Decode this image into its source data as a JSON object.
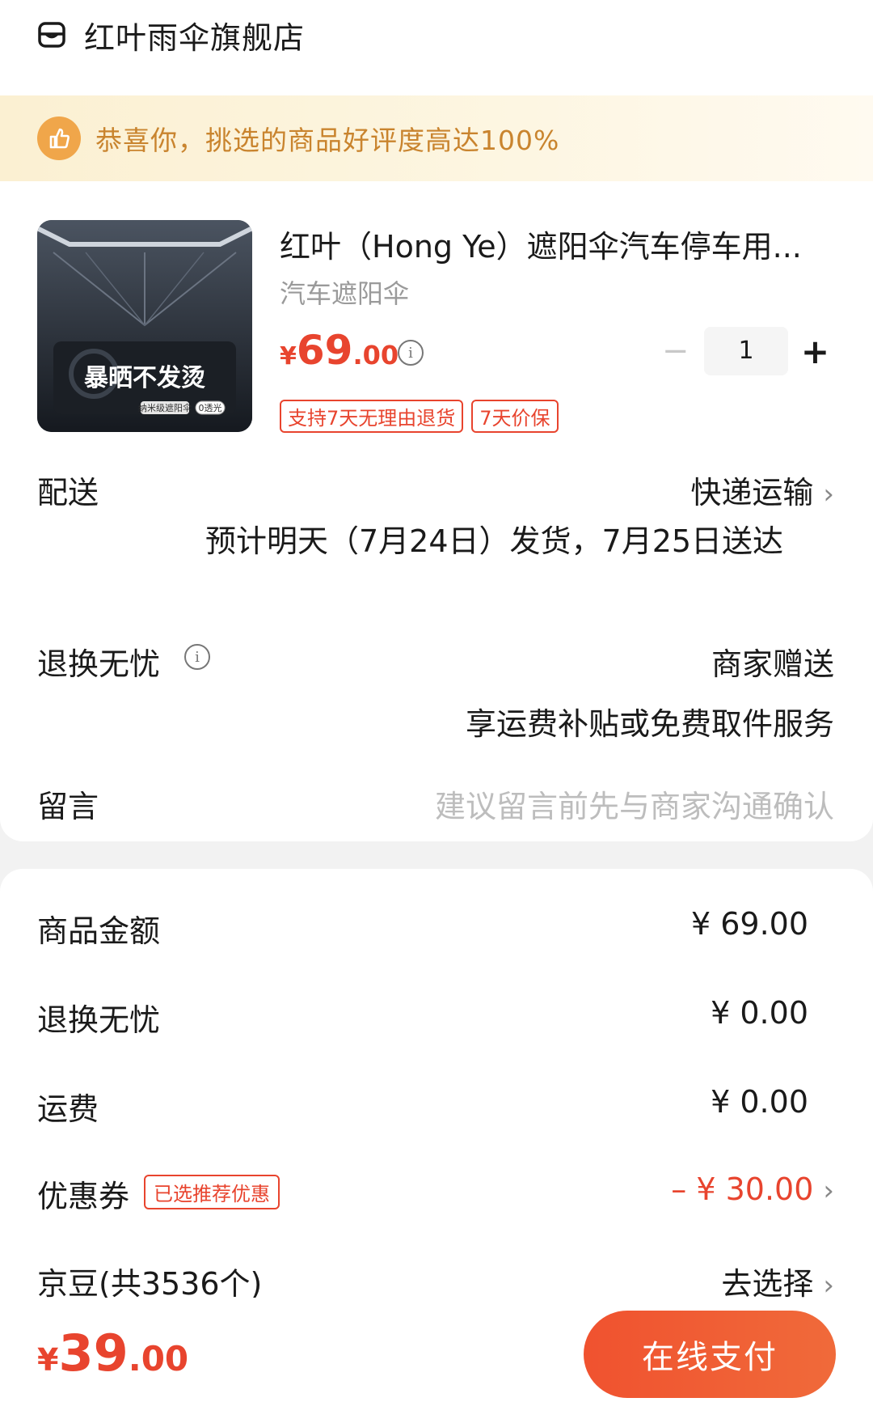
{
  "store": {
    "name": "红叶雨伞旗舰店"
  },
  "banner": {
    "text": "恭喜你，挑选的商品好评度高达100%"
  },
  "product": {
    "title": "红叶（Hong Ye）遮阳伞汽车停车用...",
    "spec": "汽车遮阳伞",
    "price_symbol": "¥",
    "price_int": "69",
    "price_dec": ".00",
    "quantity": "1",
    "tags": [
      "支持7天无理由退货",
      "7天价保"
    ],
    "image_caption": "暴晒不发烫",
    "image_subcaption": "纳米级遮阳伞",
    "image_badge": "0透光"
  },
  "delivery": {
    "label": "配送",
    "method": "快递运输",
    "estimate": "预计明天（7月24日）发货，7月25日送达"
  },
  "return_service": {
    "label": "退换无忧",
    "value": "商家赠送",
    "description": "享运费补贴或免费取件服务"
  },
  "message": {
    "label": "留言",
    "placeholder": "建议留言前先与商家沟通确认"
  },
  "summary": [
    {
      "label": "商品金额",
      "value": "¥ 69.00"
    },
    {
      "label": "退换无忧",
      "value": "¥ 0.00"
    },
    {
      "label": "运费",
      "value": "¥ 0.00"
    },
    {
      "label": "优惠券",
      "tag": "已选推荐优惠",
      "value": "– ¥ 30.00"
    },
    {
      "label": "京豆(共3536个)",
      "value": "去选择"
    }
  ],
  "footer": {
    "total_symbol": "¥",
    "total_int": "39",
    "total_dec": ".00",
    "pay_label": "在线支付"
  },
  "colors": {
    "accent": "#e8442e",
    "banner_text": "#c9842e",
    "banner_icon": "#f0a64a"
  }
}
